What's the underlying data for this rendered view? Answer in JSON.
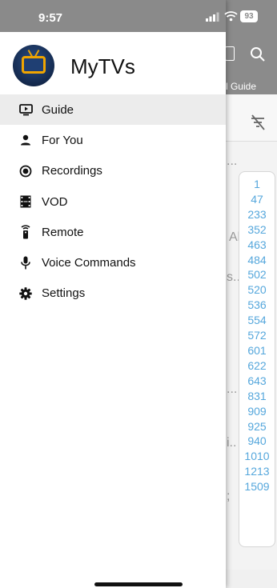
{
  "status_bar": {
    "time": "9:57",
    "battery": "93"
  },
  "app": {
    "title": "MyTVs"
  },
  "background": {
    "tab_label_fragment": "l Guide",
    "fragments": [
      "...",
      "Al",
      "s..",
      "...",
      "i..",
      ";"
    ],
    "channel_index": [
      "1",
      "47",
      "233",
      "352",
      "463",
      "484",
      "502",
      "520",
      "536",
      "554",
      "572",
      "601",
      "622",
      "643",
      "831",
      "909",
      "925",
      "940",
      "1010",
      "1213",
      "1509"
    ]
  },
  "menu": {
    "items": [
      {
        "label": "Guide",
        "icon": "guide-icon",
        "active": true
      },
      {
        "label": "For You",
        "icon": "person-icon",
        "active": false
      },
      {
        "label": "Recordings",
        "icon": "record-icon",
        "active": false
      },
      {
        "label": "VOD",
        "icon": "film-icon",
        "active": false
      },
      {
        "label": "Remote",
        "icon": "remote-icon",
        "active": false
      },
      {
        "label": "Voice Commands",
        "icon": "microphone-icon",
        "active": false
      },
      {
        "label": "Settings",
        "icon": "gear-icon",
        "active": false
      }
    ]
  },
  "colors": {
    "accent_blue": "#55a7dc",
    "header_gray": "#8a8a8a",
    "logo_orange": "#f0a500"
  }
}
